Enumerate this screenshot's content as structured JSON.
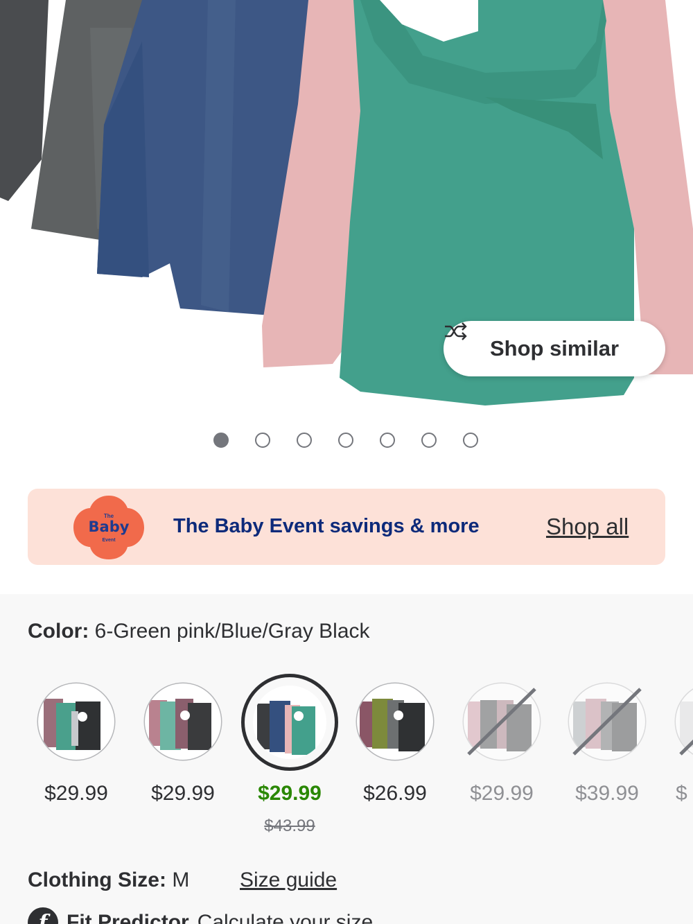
{
  "hero": {
    "shop_similar_label": "Shop similar",
    "pager": {
      "total": 7,
      "active_index": 0
    }
  },
  "promo": {
    "logo": {
      "line1": "The",
      "line2": "Baby",
      "line3": "Event"
    },
    "text": "The Baby Event savings & more",
    "link": "Shop all"
  },
  "color": {
    "label": "Color:",
    "value": "6-Green pink/Blue/Gray Black"
  },
  "swatches": [
    {
      "price": "$29.99",
      "was": "",
      "state": "available"
    },
    {
      "price": "$29.99",
      "was": "",
      "state": "available"
    },
    {
      "price": "$29.99",
      "was": "$43.99",
      "state": "selected"
    },
    {
      "price": "$26.99",
      "was": "",
      "state": "available"
    },
    {
      "price": "$29.99",
      "was": "",
      "state": "unavailable"
    },
    {
      "price": "$39.99",
      "was": "",
      "state": "unavailable"
    },
    {
      "price": "$",
      "was": "",
      "state": "unavailable"
    }
  ],
  "size": {
    "label": "Clothing Size:",
    "value": "M",
    "guide_link": "Size guide"
  },
  "fit": {
    "icon_letter": "f",
    "label": "Fit Predictor",
    "text": "Calculate your size"
  },
  "colors": {
    "accent_green": "#2a8703",
    "promo_bg": "#fde1d8",
    "promo_text": "#0d2a7a",
    "logo_orange": "#f16a4b"
  }
}
